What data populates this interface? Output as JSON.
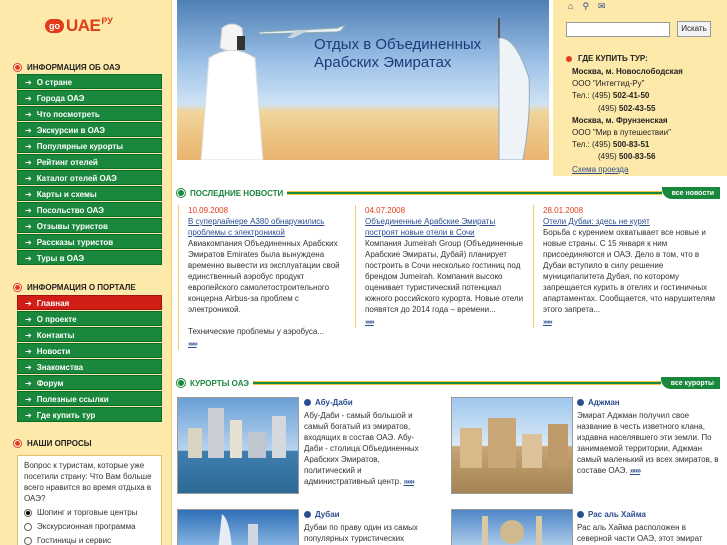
{
  "logo": {
    "go": "go",
    "brand": "UAE",
    "suffix": "РУ"
  },
  "banner": {
    "title": "Отдых в Объединенных Арабских Эмиратах"
  },
  "top_icons": [
    "home-icon",
    "search-icon",
    "mail-icon"
  ],
  "search": {
    "placeholder": "",
    "button": "Искать"
  },
  "left": {
    "info_title": "ИНФОРМАЦИЯ ОБ ОАЭ",
    "info_items": [
      "О стране",
      "Города ОАЭ",
      "Что посмотреть",
      "Экскурсии в ОАЭ",
      "Популярные курорты",
      "Рейтинг отелей",
      "Каталог отелей ОАЭ",
      "Карты и схемы",
      "Посольство ОАЭ",
      "Отзывы туристов",
      "Рассказы туристов",
      "Туры в ОАЭ"
    ],
    "portal_title": "ИНФОРМАЦИЯ О ПОРТАЛЕ",
    "portal_items": [
      "Главная",
      "О проекте",
      "Контакты",
      "Новости",
      "Знакомства",
      "Форум",
      "Полезные ссылки",
      "Где купить тур"
    ],
    "poll_title": "НАШИ ОПРОСЫ",
    "poll_question": "Вопрос к туристам, которые уже посетили страну: Что Вам больше всего нравится во время отдыха в ОАЭ?",
    "poll_options": [
      "Шопинг и торговые центры",
      "Экскурсионная программа",
      "Гостиницы и сервис"
    ]
  },
  "buy": {
    "title": "ГДЕ КУПИТЬ ТУР:",
    "office1": {
      "name": "Москва, м. Новослободская",
      "company": "ООО \"Интегтид-Ру\"",
      "tel_label": "Тел.:",
      "tel1_code": "(495)",
      "tel1": "502-41-50",
      "tel2_code": "(495)",
      "tel2": "502-43-55"
    },
    "office2": {
      "name": "Москва, м. Фрунзенская",
      "company": "ООО \"Мир в путешествии\"",
      "tel_label": "Тел.:",
      "tel1_code": "(495)",
      "tel1": "500-83-51",
      "tel2_code": "(495)",
      "tel2": "500-83-56"
    },
    "map_link": "Схема проезда"
  },
  "news": {
    "title": "ПОСЛЕДНИЕ НОВОСТИ",
    "all": "все новости",
    "items": [
      {
        "date": "10.09.2008",
        "headline": "В суперлайнере А380 обнаружились проблемы с электроникой",
        "text": "Авиакомпания Объединенных Арабских Эмиратов Emirates была вынуждена временно вывести из эксплуатации свой единственный аэробус продукт европейского самолетостроительного концерна Airbus-за проблем с электроникой.",
        "text2": "Технические проблемы у аэробуса...",
        "more": "»»»"
      },
      {
        "date": "04.07.2008",
        "headline": "Объединенные Арабские Эмираты построят новые отели в Сочи",
        "text": "Компания Jumeirah Group (Объединенные Арабские Эмираты, Дубай) планирует построить в Сочи несколько гостиниц под брендом Jumeirah. Компания высоко оценивает туристический потенциал южного российского курорта. Новые отели появятся до 2014 года – времени...",
        "more": "»»»"
      },
      {
        "date": "28.01.2008",
        "headline": "Отели Дубаи: здесь не курят",
        "text": "Борьба с курением охватывает все новые и новые страны. С 15 января к ним присоединяются и ОАЭ. Дело в том, что в Дубаи вступило в силу решение муниципалитета Дубая, по которому запрещается курить в отелях и гостиничных апартаментах. Сообщается, что нарушителям этого запрета...",
        "more": "»»»"
      }
    ]
  },
  "resorts": {
    "title": "КУРОРТЫ ОАЭ",
    "all": "все курорты",
    "items": [
      {
        "name": "Абу-Даби",
        "text": "Абу-Даби - самый большой и самый богатый из эмиратов, входящих в состав ОАЭ. Абу-Даби - столица Объединенных Арабских Эмиратов, политический и административный центр.",
        "more": "»»»"
      },
      {
        "name": "Аджман",
        "text": "Эмират Аджман получил свое название в честь изветного клана, издавна населявшего эти земли. По занимаемой территории, Аджман самый маленький из всех эмиратов, в составе ОАЭ.",
        "more": "»»»"
      },
      {
        "name": "Дубаи",
        "text": "Дубаи по праву один из самых популярных туристических"
      },
      {
        "name": "Рас аль Хайма",
        "text": "Рас аль Хайма расположен в северной части ОАЭ, этот эмират"
      }
    ]
  }
}
